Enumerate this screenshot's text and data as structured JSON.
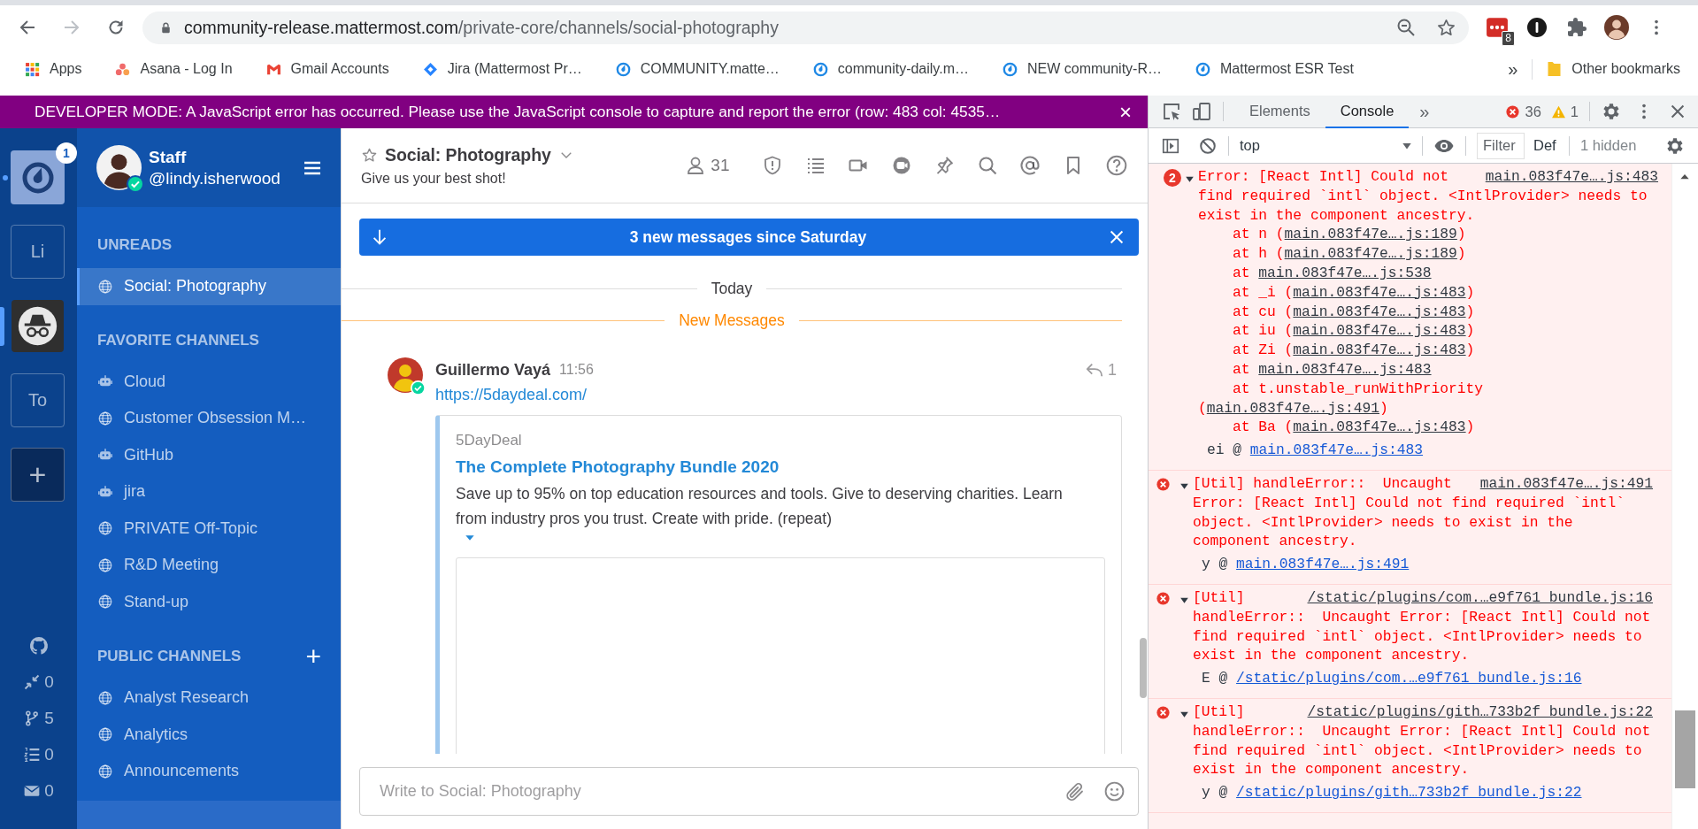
{
  "browser": {
    "url_host": "community-release.mattermost.com",
    "url_path": "/private-core/channels/social-photography",
    "bookmarked": false,
    "extensions": [
      {
        "kind": "dots",
        "badge": "8"
      },
      {
        "kind": "keyhole"
      },
      {
        "kind": "puzzle"
      },
      {
        "kind": "profile"
      }
    ],
    "bookmarks": [
      {
        "kind": "apps",
        "label": "Apps"
      },
      {
        "kind": "asana",
        "label": "Asana - Log In"
      },
      {
        "kind": "gmail",
        "label": "Gmail Accounts"
      },
      {
        "kind": "jira",
        "label": "Jira (Mattermost Pr…"
      },
      {
        "kind": "mattermost",
        "label": "COMMUNITY.matte…"
      },
      {
        "kind": "mattermost",
        "label": "community-daily.m…"
      },
      {
        "kind": "mattermost",
        "label": "NEW community-R…"
      },
      {
        "kind": "mattermost",
        "label": "Mattermost ESR Test"
      }
    ],
    "overflow": "»",
    "other_bookmarks": "Other bookmarks"
  },
  "dev_banner": {
    "text": "DEVELOPER MODE: A JavaScript error has occurred. Please use the JavaScript console to capture and report the error (row: 483 col: 4535…",
    "close": "×"
  },
  "teams": [
    {
      "kind": "logo",
      "badge": "1",
      "unread": true,
      "selected": false
    },
    {
      "kind": "initials",
      "label": "Li",
      "unread": false,
      "selected": false
    },
    {
      "kind": "avatar",
      "unread": false,
      "selected": true
    },
    {
      "kind": "initials",
      "label": "To",
      "unread": false,
      "selected": false
    }
  ],
  "add_team": "+",
  "plugins": [
    {
      "kind": "github"
    },
    {
      "kind": "review",
      "count": "0"
    },
    {
      "kind": "branch",
      "count": "5"
    },
    {
      "kind": "todo",
      "count": "0"
    },
    {
      "kind": "mail",
      "count": "0"
    }
  ],
  "sidebar": {
    "team_name": "Staff",
    "username": "@lindy.isherwood",
    "sections": [
      {
        "title": "UNREADS",
        "items": [
          {
            "kind": "public",
            "name": "Social: Photography",
            "selected": true
          }
        ]
      },
      {
        "title": "FAVORITE CHANNELS",
        "items": [
          {
            "kind": "bot",
            "name": "Cloud",
            "selected": false
          },
          {
            "kind": "public",
            "name": "Customer Obsession M…",
            "selected": false
          },
          {
            "kind": "bot",
            "name": "GitHub",
            "selected": false
          },
          {
            "kind": "bot",
            "name": "jira",
            "selected": false
          },
          {
            "kind": "public",
            "name": "PRIVATE Off-Topic",
            "selected": false
          },
          {
            "kind": "public",
            "name": "R&D Meeting",
            "selected": false
          },
          {
            "kind": "public",
            "name": "Stand-up",
            "selected": false
          }
        ]
      },
      {
        "title": "PUBLIC CHANNELS",
        "add": "+",
        "items": [
          {
            "kind": "public",
            "name": "Analyst Research",
            "selected": false
          },
          {
            "kind": "public",
            "name": "Analytics",
            "selected": false
          },
          {
            "kind": "public",
            "name": "Announcements",
            "selected": false
          }
        ]
      }
    ]
  },
  "channel": {
    "favorite": false,
    "name": "Social: Photography",
    "purpose": "Give us your best shot!",
    "member_count": "31",
    "new_messages": "3 new messages since Saturday",
    "date_separator": "Today",
    "new_separator": "New Messages",
    "posts": [
      {
        "author": "Guillermo Vayá",
        "time": "11:56",
        "reply_count": "1",
        "link": "https://5daydeal.com/",
        "embed": {
          "site": "5DayDeal",
          "title": "The Complete Photography Bundle 2020",
          "description": "Save up to 95% on top education resources and tools. Give to deserving charities. Learn from industry pros you trust. Create with pride. (repeat)"
        }
      }
    ],
    "composer_placeholder": "Write to Social: Photography"
  },
  "devtools": {
    "tabs": [
      {
        "label": "Elements",
        "selected": false
      },
      {
        "label": "Console",
        "selected": true
      }
    ],
    "more": "»",
    "error_count": "36",
    "warning_count": "1",
    "context": "top",
    "filter_placeholder": "Filter",
    "levels": "Def",
    "hidden": "1 hidden",
    "messages": [
      {
        "repeat": "2",
        "head": "Error: [React Intl] Could not",
        "text": "find required `intl` object. <IntlProvider> needs to exist in the component ancestry.",
        "source": "main.083f47e….js:483",
        "stack": [
          {
            "text": "at n (",
            "link": "main.083f47e….js:189",
            "after": ")"
          },
          {
            "text": "at h (",
            "link": "main.083f47e….js:189",
            "after": ")"
          },
          {
            "text": "at ",
            "link": "main.083f47e….js:538"
          },
          {
            "text": "at _i (",
            "link": "main.083f47e….js:483",
            "after": ")"
          },
          {
            "text": "at cu (",
            "link": "main.083f47e….js:483",
            "after": ")"
          },
          {
            "text": "at iu (",
            "link": "main.083f47e….js:483",
            "after": ")"
          },
          {
            "text": "at Zi (",
            "link": "main.083f47e….js:483",
            "after": ")"
          },
          {
            "text": "at ",
            "link": "main.083f47e….js:483"
          },
          {
            "text": "at t.unstable_runWithPriority (",
            "link": "main.083f47e….js:491",
            "after": ")"
          },
          {
            "text": "at Ba (",
            "link": "main.083f47e….js:483",
            "after": ")"
          }
        ],
        "trace": {
          "caller": "ei @",
          "link": "main.083f47e….js:483"
        }
      },
      {
        "head": "[Util] handleError::  Uncaught",
        "text": "Error: [React Intl] Could not find required `intl` object. <IntlProvider> needs to exist in the component ancestry.",
        "source": "main.083f47e….js:491",
        "trace": {
          "caller": "y @",
          "link": "main.083f47e….js:491"
        }
      },
      {
        "head": "[Util]",
        "text": "handleError::  Uncaught Error: [React Intl] Could not find required `intl` object. <IntlProvider> needs to exist in the component ancestry.",
        "source": "/static/plugins/com.…e9f761_bundle.js:16",
        "trace": {
          "caller": "E @",
          "link": "/static/plugins/com.…e9f761_bundle.js:16"
        }
      },
      {
        "head": "[Util]",
        "text": "handleError::  Uncaught Error: [React Intl] Could not find required `intl` object. <IntlProvider> needs to exist in the component ancestry.",
        "source": "/static/plugins/gith…733b2f_bundle.js:22",
        "trace": {
          "caller": "y @",
          "link": "/static/plugins/gith…733b2f_bundle.js:22"
        }
      }
    ]
  }
}
